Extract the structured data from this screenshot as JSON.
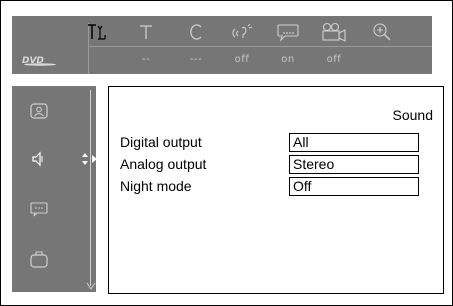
{
  "menu_bar": {
    "items": [
      {
        "icon": "preferences-icon",
        "value": ""
      },
      {
        "icon": "title-icon",
        "value": "--"
      },
      {
        "icon": "chapter-icon",
        "value": "---"
      },
      {
        "icon": "audio-icon",
        "value": "off"
      },
      {
        "icon": "subtitle-icon",
        "value": "on"
      },
      {
        "icon": "angle-icon",
        "value": "off"
      },
      {
        "icon": "zoom-icon",
        "value": ""
      }
    ],
    "logo_text": "DVD"
  },
  "side_menu": {
    "items": [
      {
        "icon": "picture-icon",
        "selected": false
      },
      {
        "icon": "sound-icon",
        "selected": true
      },
      {
        "icon": "language-icon",
        "selected": false
      },
      {
        "icon": "features-icon",
        "selected": false
      }
    ]
  },
  "panel": {
    "title": "Sound",
    "rows": [
      {
        "label": "Digital output",
        "value": "All"
      },
      {
        "label": "Analog output",
        "value": "Stereo"
      },
      {
        "label": "Night mode",
        "value": "Off"
      }
    ]
  },
  "colors": {
    "bar_bg": "#767676",
    "icon_color": "#cfcfcf",
    "selected_icon": "#ffffff"
  }
}
